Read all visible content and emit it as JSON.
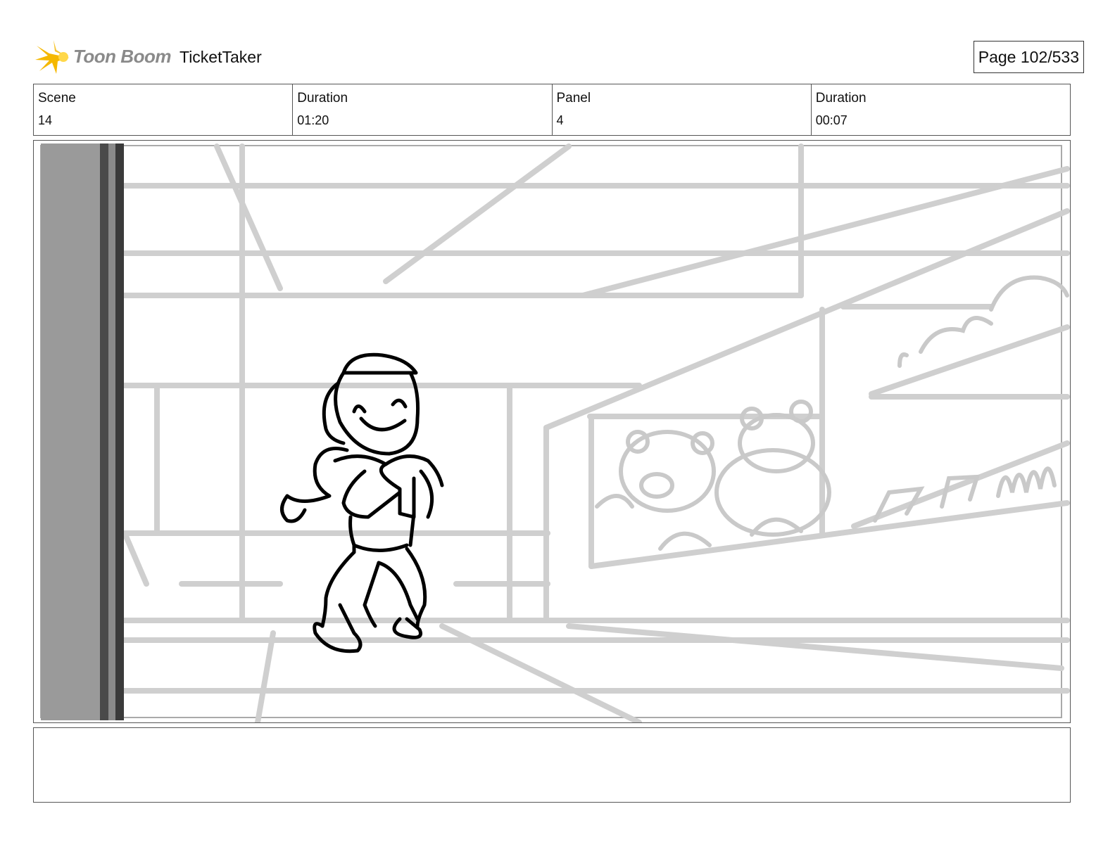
{
  "header": {
    "logo_text": "Toon Boom",
    "project_title": "TicketTaker",
    "page_label": "Page 102/533"
  },
  "info": [
    {
      "label": "Scene",
      "value": "14"
    },
    {
      "label": "Duration",
      "value": "01:20"
    },
    {
      "label": "Panel",
      "value": "4"
    },
    {
      "label": "Duration",
      "value": "00:07"
    }
  ],
  "colors": {
    "logo_star": "#f5b800",
    "sketch_gray": "#c8c8c8",
    "character_ink": "#000000"
  },
  "notes": ""
}
